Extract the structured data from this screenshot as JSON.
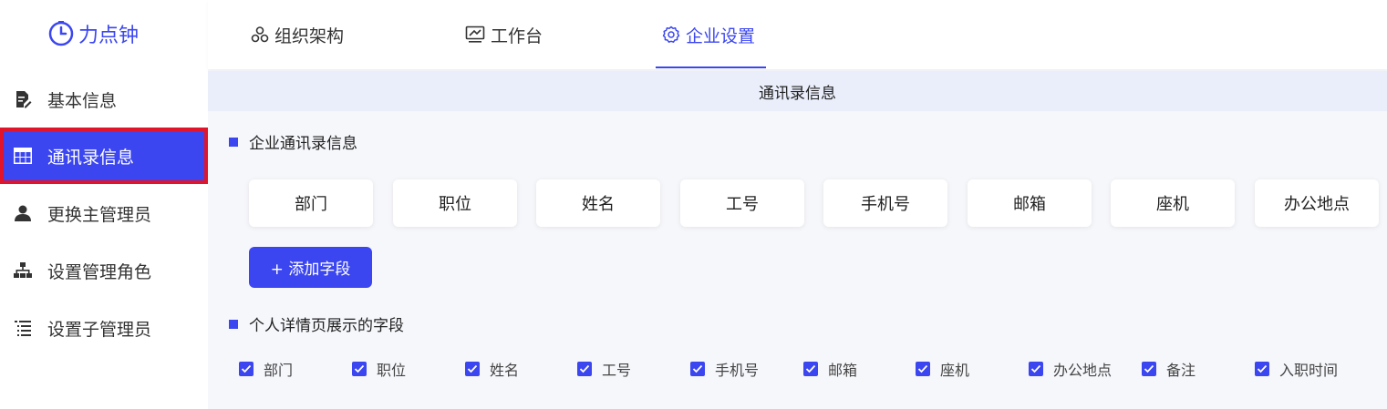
{
  "app": {
    "logo_text": "力点钟",
    "logo_icon": "clock-icon"
  },
  "sidebar": {
    "items": [
      {
        "label": "基本信息",
        "icon": "document-edit-icon"
      },
      {
        "label": "通讯录信息",
        "icon": "table-icon",
        "active": true
      },
      {
        "label": "更换主管理员",
        "icon": "user-icon"
      },
      {
        "label": "设置管理角色",
        "icon": "org-chart-icon"
      },
      {
        "label": "设置子管理员",
        "icon": "list-tree-icon"
      }
    ]
  },
  "topnav": {
    "tabs": [
      {
        "label": "组织架构",
        "icon": "team-icon"
      },
      {
        "label": "工作台",
        "icon": "monitor-icon"
      },
      {
        "label": "企业设置",
        "icon": "gear-icon",
        "active": true
      }
    ]
  },
  "page": {
    "subheader": "通讯录信息",
    "section1_title": "企业通讯录信息",
    "fields": [
      "部门",
      "职位",
      "姓名",
      "工号",
      "手机号",
      "邮箱",
      "座机",
      "办公地点"
    ],
    "add_field_label": "+ 添加字段",
    "section2_title": "个人详情页展示的字段",
    "detail_fields": [
      {
        "label": "部门",
        "checked": true
      },
      {
        "label": "职位",
        "checked": true
      },
      {
        "label": "姓名",
        "checked": true
      },
      {
        "label": "工号",
        "checked": true
      },
      {
        "label": "手机号",
        "checked": true
      },
      {
        "label": "邮箱",
        "checked": true
      },
      {
        "label": "座机",
        "checked": true
      },
      {
        "label": "办公地点",
        "checked": true
      },
      {
        "label": "备注",
        "checked": true
      },
      {
        "label": "入职时间",
        "checked": true
      }
    ]
  },
  "colors": {
    "accent": "#3b46f0",
    "highlight_border": "#e0142a",
    "subheader_bg": "#eaeefb"
  }
}
